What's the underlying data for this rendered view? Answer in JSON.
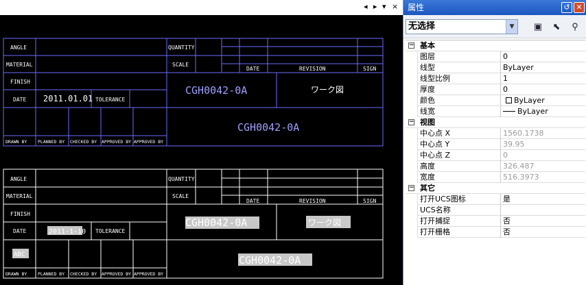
{
  "canvas_toolbar": {
    "pin": "◂",
    "next": "▸",
    "menu": "▾",
    "close": "×"
  },
  "panel": {
    "title": "属性",
    "selection": "无选择",
    "icons": [
      "quick-select-icon",
      "select-objects-icon",
      "filter-icon"
    ]
  },
  "properties": {
    "basic": {
      "label": "基本",
      "rows": [
        {
          "label": "图层",
          "value": "0"
        },
        {
          "label": "线型",
          "value": "ByLayer"
        },
        {
          "label": "线型比例",
          "value": "1"
        },
        {
          "label": "厚度",
          "value": "0"
        },
        {
          "label": "颜色",
          "value": "ByLayer"
        },
        {
          "label": "线宽",
          "value": "ByLayer"
        }
      ]
    },
    "view": {
      "label": "视图",
      "rows": [
        {
          "label": "中心点 X",
          "value": "1560.1738"
        },
        {
          "label": "中心点 Y",
          "value": "39.95"
        },
        {
          "label": "中心点 Z",
          "value": "0"
        },
        {
          "label": "高度",
          "value": "326.487"
        },
        {
          "label": "宽度",
          "value": "516.3973"
        }
      ]
    },
    "misc": {
      "label": "其它",
      "rows": [
        {
          "label": "打开UCS图标",
          "value": "是"
        },
        {
          "label": "UCS名称",
          "value": ""
        },
        {
          "label": "打开捕捉",
          "value": "否"
        },
        {
          "label": "打开栅格",
          "value": "否"
        }
      ]
    }
  },
  "drawing": {
    "block1": {
      "angle": "ANGLE",
      "quantity": "QUANTITY",
      "material": "MATERIAL",
      "scale": "SCALE",
      "date_col": "DATE",
      "revision": "REVISION",
      "sign": "SIGN",
      "finish": "FINISH",
      "part": "CGH0042-0A",
      "kana": "ワーク図",
      "date": "DATE",
      "date_value": "2011.01.01",
      "tolerance": "TOLERANCE",
      "part2": "CGH0042-0A",
      "drawn": "DRAWN BY",
      "planned": "PLANNED BY",
      "checked": "CHECKED BY",
      "approved1": "APPROVED BY",
      "approved2": "APPROVED BY"
    },
    "block2": {
      "angle": "ANGLE",
      "quantity": "QUANTITY",
      "material": "MATERIAL",
      "scale": "SCALE",
      "date_col": "DATE",
      "revision": "REVISION",
      "sign": "SIGN",
      "finish": "FINISH",
      "part": "CGH0042-0A",
      "kana": "ワーク図",
      "date": "DATE",
      "date_value": "2011-1-10",
      "tolerance": "TOLERANCE",
      "abc": "ABC",
      "part2": "CGH0042-0A",
      "drawn": "DRAWN BY",
      "planned": "PLANNED BY",
      "checked": "CHECKED BY",
      "approved1": "APPROVED BY",
      "approved2": "APPROVED BY"
    }
  },
  "colors": {
    "line": "#6b6bff",
    "text": "#ffffff",
    "part_text": "#a0a0ff",
    "highlight": "#c8c8c8"
  }
}
